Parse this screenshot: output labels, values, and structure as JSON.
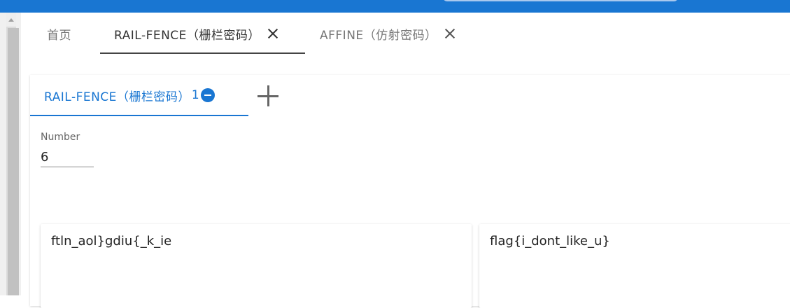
{
  "top_tabs": [
    {
      "label": "首页"
    },
    {
      "label": "RAIL-FENCE（栅栏密码）"
    },
    {
      "label": "AFFINE（仿射密码）"
    }
  ],
  "inner_tab": {
    "label": "RAIL-FENCE（栅栏密码）",
    "count": "1"
  },
  "number_field": {
    "label": "Number",
    "value": "6"
  },
  "input_text": "ftln_aol}gdiu{_k_ie",
  "output_text": "flag{i_dont_like_u}",
  "colors": {
    "primary": "#1976d2",
    "topbar": "#1976d2"
  },
  "icons": {
    "close": "close-icon",
    "remove": "remove-circle-icon",
    "add": "add-icon"
  }
}
